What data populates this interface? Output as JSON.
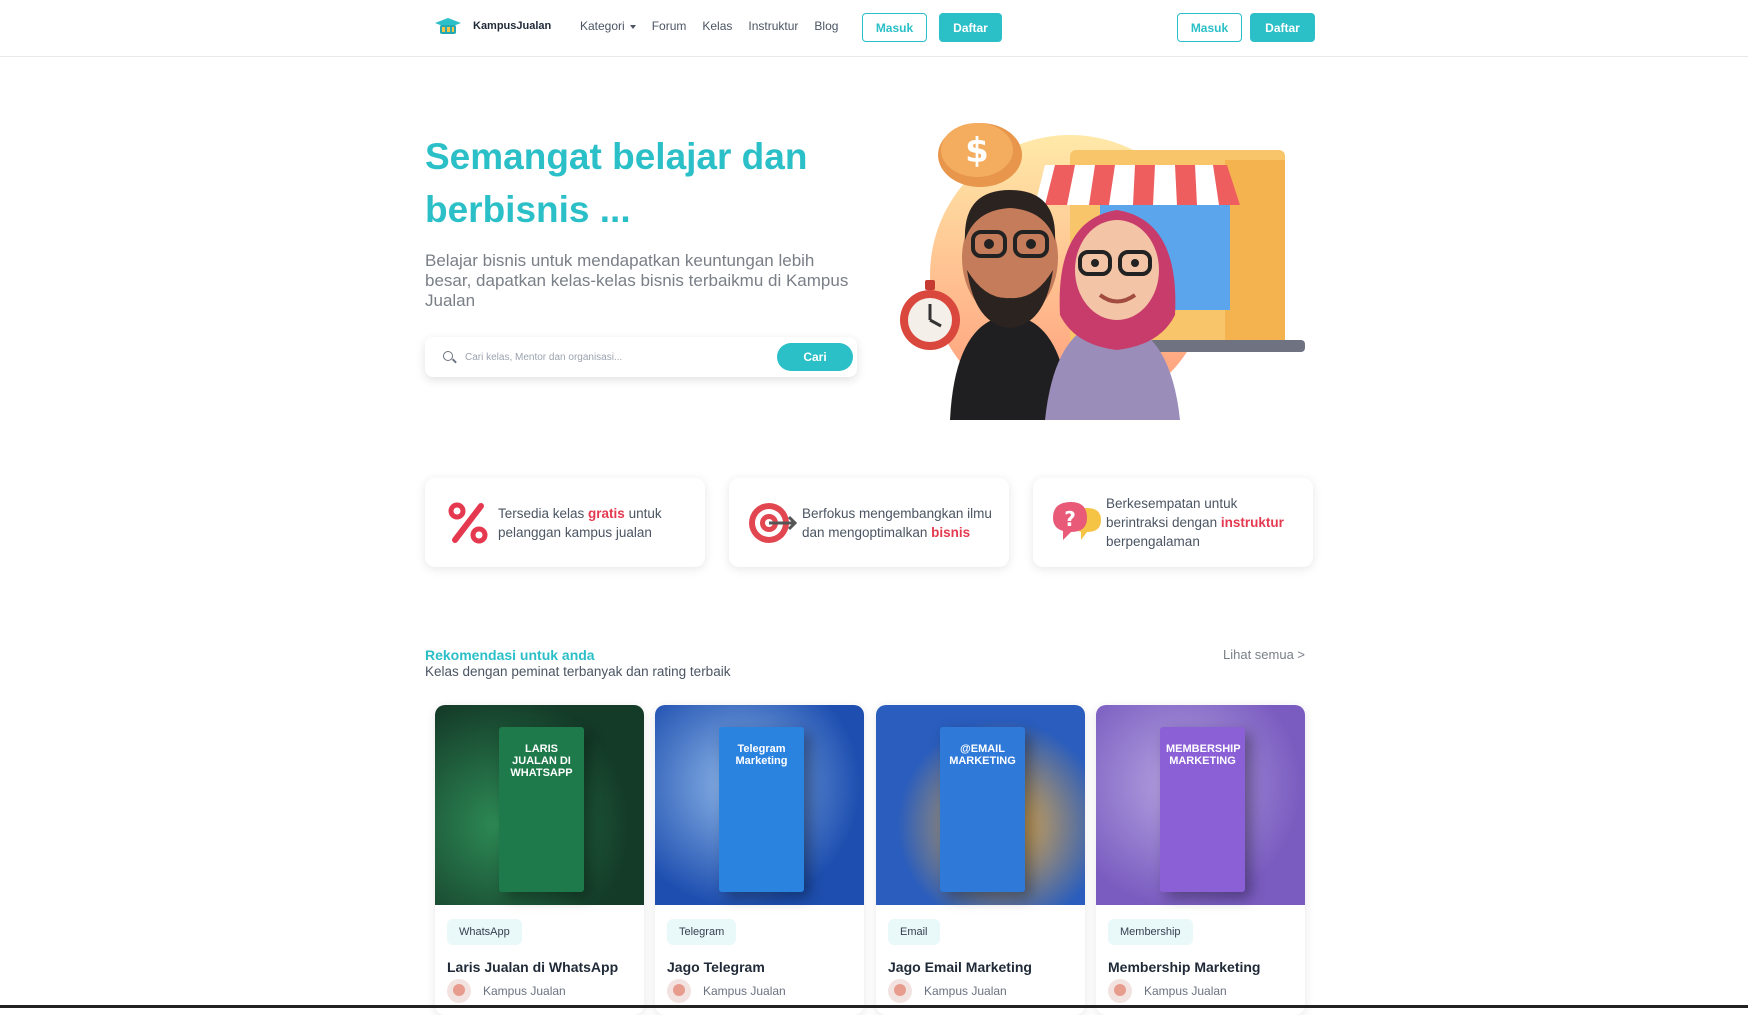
{
  "header": {
    "brand": "KampusJualan",
    "nav": [
      {
        "label": "Kategori",
        "has_dropdown": true
      },
      {
        "label": "Forum"
      },
      {
        "label": "Kelas"
      },
      {
        "label": "Instruktur"
      },
      {
        "label": "Blog"
      }
    ],
    "login_label": "Masuk",
    "register_label": "Daftar",
    "right_login_label": "Masuk",
    "right_register_label": "Daftar"
  },
  "hero": {
    "title": "Semangat belajar dan berbisnis ...",
    "subtitle": "Belajar bisnis untuk mendapatkan keuntungan lebih besar, dapatkan kelas-kelas bisnis terbaikmu di Kampus Jualan",
    "search_placeholder": "Cari kelas, Mentor dan organisasi...",
    "search_button": "Cari"
  },
  "features": [
    {
      "icon": "percent-icon",
      "before": "Tersedia kelas ",
      "highlight": "gratis",
      "after": " untuk pelanggan kampus jualan"
    },
    {
      "icon": "target-icon",
      "before": "Berfokus mengembangkan ilmu dan mengoptimalkan ",
      "highlight": "bisnis",
      "after": ""
    },
    {
      "icon": "question-chat-icon",
      "before": "Berkesempatan untuk berintraksi dengan ",
      "highlight": "instruktur",
      "after": " berpengalaman"
    }
  ],
  "recommendations": {
    "title": "Rekomendasi untuk anda",
    "subtitle": "Kelas dengan peminat terbanyak dan rating terbaik",
    "see_all": "Lihat semua >",
    "cards": [
      {
        "tag": "WhatsApp",
        "title": "Laris Jualan di WhatsApp",
        "author": "Kampus Jualan",
        "cover_text": "LARIS JUALAN DI WHATSAPP",
        "bg": "#1f5b3a",
        "book": "#1e7a4a"
      },
      {
        "tag": "Telegram",
        "title": "Jago Telegram",
        "author": "Kampus Jualan",
        "cover_text": "Telegram Marketing",
        "bg": "#2f63c8",
        "book": "#2b83e0"
      },
      {
        "tag": "Email",
        "title": "Jago Email Marketing",
        "author": "Kampus Jualan",
        "cover_text": "@EMAIL MARKETING",
        "bg": "#2a5dbd",
        "book": "#2f7ad8"
      },
      {
        "tag": "Membership",
        "title": "Membership Marketing",
        "author": "Kampus Jualan",
        "cover_text": "MEMBERSHIP MARKETING",
        "bg": "#8a68c9",
        "book": "#8b5fd6"
      }
    ]
  },
  "colors": {
    "accent": "#2bbfc7",
    "highlight": "#e53950"
  }
}
